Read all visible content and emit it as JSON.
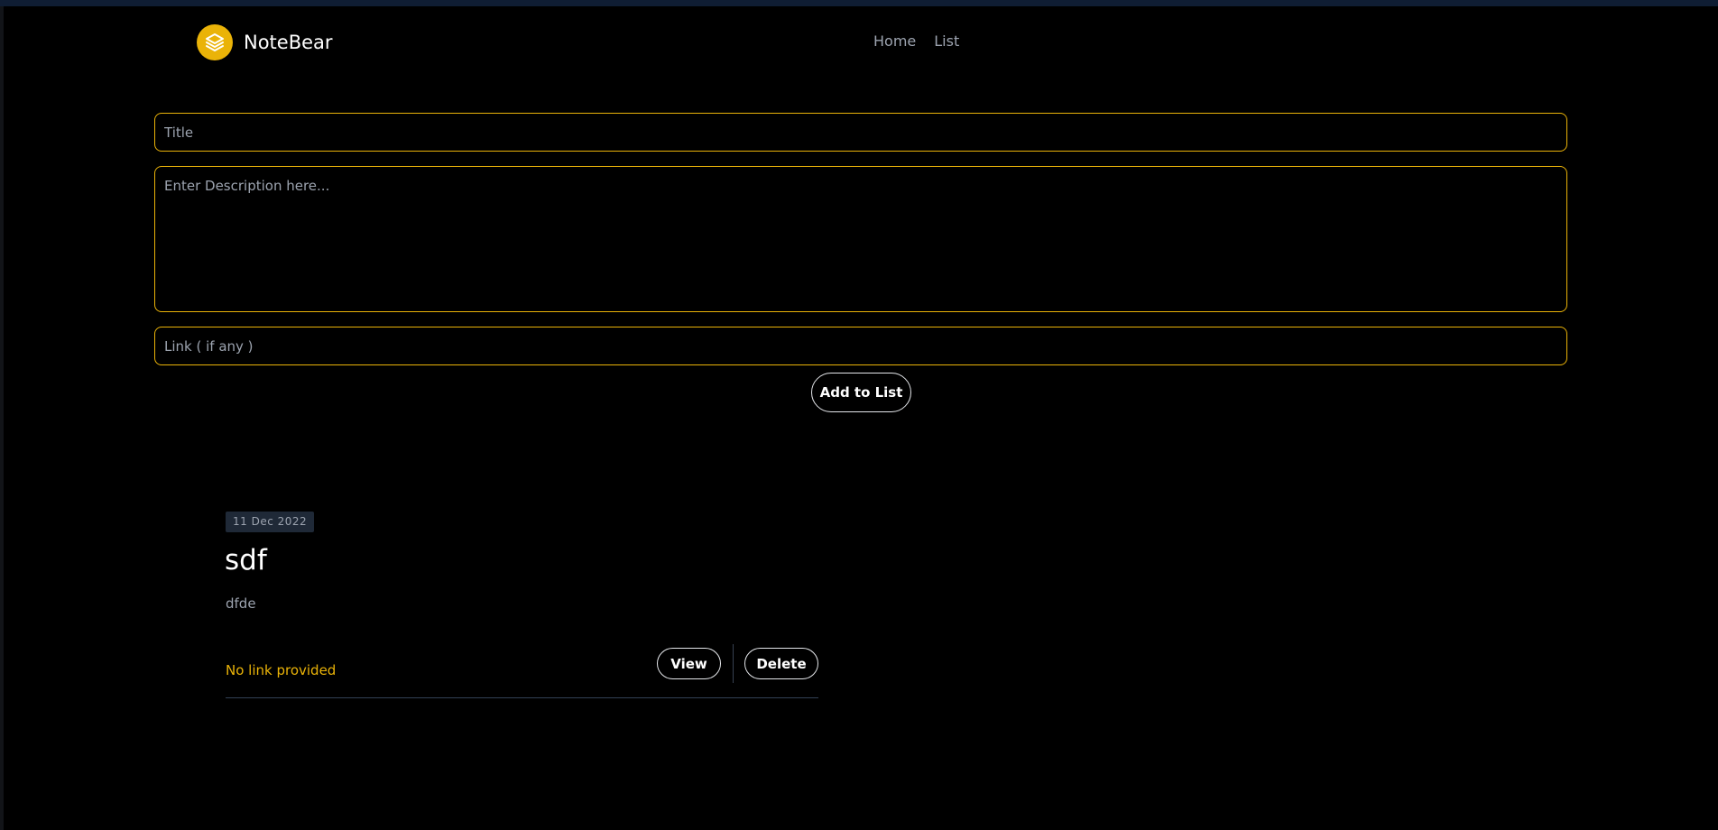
{
  "header": {
    "brand_name": "NoteBear",
    "nav": [
      {
        "label": "Home"
      },
      {
        "label": "List"
      }
    ]
  },
  "form": {
    "title_placeholder": "Title",
    "title_value": "",
    "description_placeholder": "Enter Description here...",
    "description_value": "",
    "link_placeholder": "Link ( if any )",
    "link_value": "",
    "submit_label": "Add to List"
  },
  "notes": [
    {
      "date": "11 Dec 2022",
      "title": "sdf",
      "description": "dfde",
      "link_text": "No link provided",
      "view_label": "View",
      "delete_label": "Delete"
    }
  ],
  "colors": {
    "accent": "#eab308",
    "background": "#000000",
    "badge_bg": "#1f2937"
  },
  "icons": {
    "logo": "layers-icon"
  }
}
